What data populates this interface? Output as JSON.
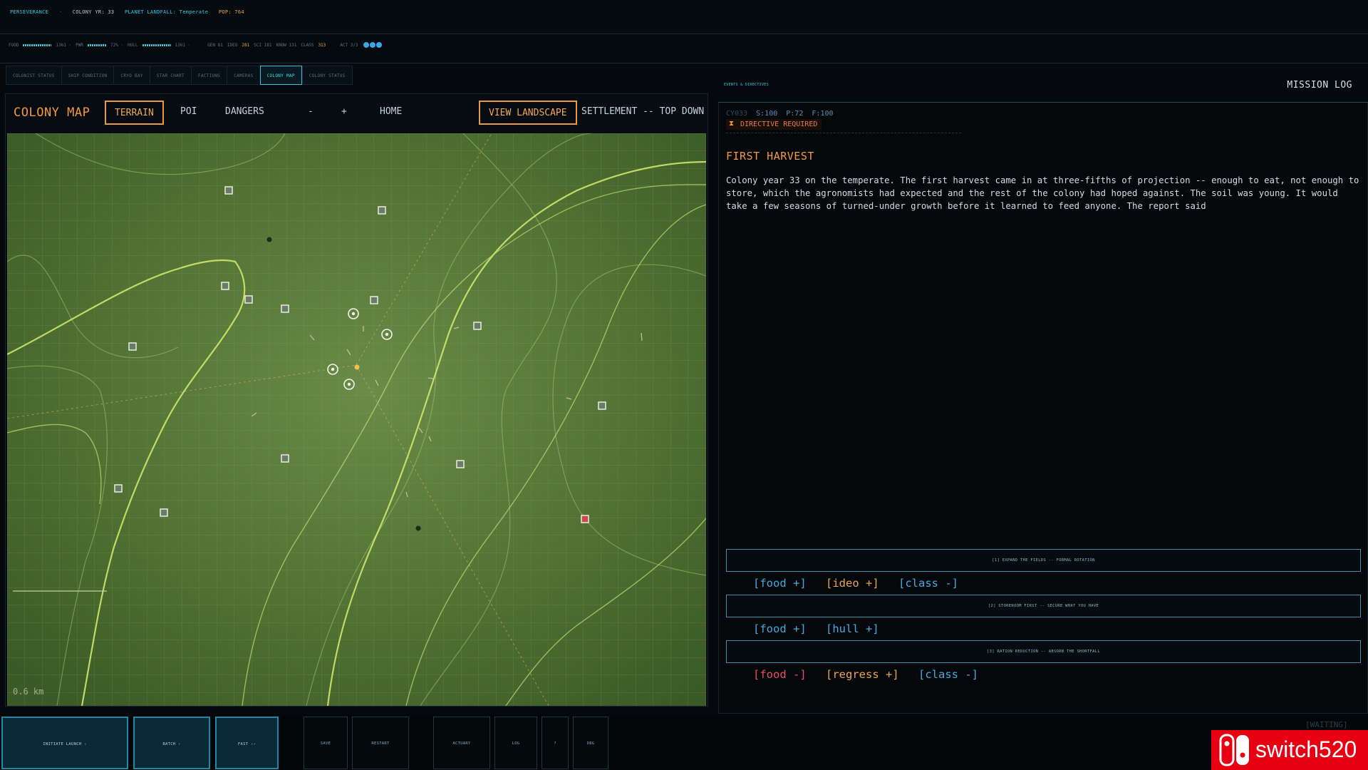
{
  "topbar": {
    "segments": [
      "PERSEVERANCE",
      "·",
      "COLONY YR: 33",
      "PLANET LANDFALL: Temperate",
      "POP: 764"
    ],
    "resources": {
      "food": "FOOD",
      "food_val": "1361 ·",
      "pwr": "PWR",
      "pwr_val": "72% ·",
      "hull": "HULL",
      "hull_val": "1361 ·",
      "gen": "GEN 81",
      "ideo": "IDEO",
      "ideo_val": "281",
      "sci": "SCI 181",
      "know": "KNOW 131",
      "class": "CLASS",
      "class_val": "313",
      "act": "ACT 3/3"
    }
  },
  "tabs": [
    "COLONIST STATUS",
    "SHIP CONDITION",
    "CRYO BAY",
    "STAR CHART",
    "FACTIONS",
    "CAMERAS",
    "COLONY MAP",
    "COLONY STATUS"
  ],
  "map": {
    "title": "COLONY MAP",
    "terrain": "TERRAIN",
    "poi": "POI",
    "dangers": "DANGERS",
    "zoom_out": "-",
    "zoom_in": "+",
    "home": "HOME",
    "view_landscape": "VIEW LANDSCAPE",
    "settlement": "SETTLEMENT -- TOP DOWN",
    "scale": "0.6 km"
  },
  "log": {
    "eyebrow": "EVENTS & DIRECTIVES",
    "title": "MISSION LOG",
    "stats": [
      "CY033",
      "S:100",
      "P:72",
      "F:100"
    ],
    "directive": "DIRECTIVE REQUIRED",
    "event_title": "FIRST HARVEST",
    "event_body": "Colony year 33 on the temperate. The first harvest came in at three-fifths of projection -- enough to eat, not enough to store, which the agronomists had expected and the rest of the colony had hoped against. The soil was young. It would take a few seasons of turned-under growth before it learned to feed anyone. The report said",
    "choices": [
      {
        "label": "[1]  EXPAND THE FIELDS -- FORMAL ROTATION",
        "tags": [
          {
            "t": "[food +]",
            "c": "blue"
          },
          {
            "t": "[ideo +]",
            "c": "amber"
          },
          {
            "t": "[class -]",
            "c": "blue"
          }
        ]
      },
      {
        "label": "[2]  STOREROOM FIRST -- SECURE WHAT YOU HAVE",
        "tags": [
          {
            "t": "[food +]",
            "c": "blue"
          },
          {
            "t": "[hull +]",
            "c": "blue"
          }
        ]
      },
      {
        "label": "[3]  RATION REDUCTION -- ABSORB THE SHORTFALL",
        "tags": [
          {
            "t": "[food -]",
            "c": "red"
          },
          {
            "t": "[regress +]",
            "c": "amber"
          },
          {
            "t": "[class -]",
            "c": "blue"
          }
        ]
      }
    ]
  },
  "bottom": {
    "initiate": "INITIATE LAUNCH ›",
    "batch": "BATCH ›",
    "fast": "FAST ››",
    "save": "SAVE",
    "restart": "RESTART",
    "actuary": "ACTUARY",
    "log": "LOG",
    "help": "?",
    "dbg": "DBG",
    "waiting": "[WAITING]"
  },
  "watermark": {
    "text": "switch520",
    "color": "#e60012"
  },
  "colors": {
    "accent_orange": "#f29840",
    "accent_cyan": "#38c8e0",
    "map_green": "#50702f"
  }
}
